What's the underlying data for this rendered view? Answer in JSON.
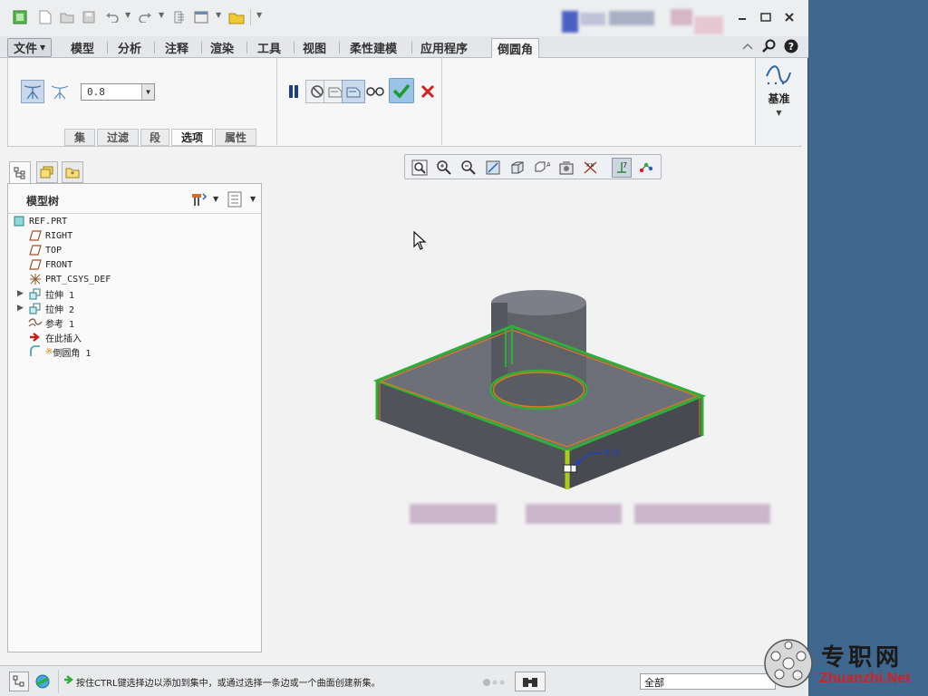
{
  "ribbon_tabs": [
    {
      "label": "文件"
    },
    {
      "label": "模型"
    },
    {
      "label": "分析"
    },
    {
      "label": "注释"
    },
    {
      "label": "渲染"
    },
    {
      "label": "工具"
    },
    {
      "label": "视图"
    },
    {
      "label": "柔性建模"
    },
    {
      "label": "应用程序"
    },
    {
      "label": "倒圆角"
    }
  ],
  "round_tool": {
    "radius_value": "0.8",
    "datum_label": "基准",
    "subtabs": [
      "集",
      "过滤",
      "段",
      "选项",
      "属性"
    ],
    "active_subtab": "选项"
  },
  "model_tree": {
    "title": "模型树",
    "items": [
      {
        "label": "REF.PRT",
        "icon": "part-icon",
        "expandable": false
      },
      {
        "label": "RIGHT",
        "icon": "datum-plane-icon",
        "expandable": false
      },
      {
        "label": "TOP",
        "icon": "datum-plane-icon",
        "expandable": false
      },
      {
        "label": "FRONT",
        "icon": "datum-plane-icon",
        "expandable": false
      },
      {
        "label": "PRT_CSYS_DEF",
        "icon": "csys-icon",
        "expandable": false
      },
      {
        "label": "拉伸 1",
        "icon": "extrude-icon",
        "expandable": true
      },
      {
        "label": "拉伸 2",
        "icon": "extrude-icon",
        "expandable": true
      },
      {
        "label": "参考 1",
        "icon": "reference-icon",
        "expandable": false
      },
      {
        "label": "在此插入",
        "icon": "insert-here-icon",
        "expandable": false
      },
      {
        "label": "倒圆角 1",
        "icon": "round-icon",
        "expandable": false
      }
    ],
    "round_prefix": "※"
  },
  "graphics": {
    "dimension_label": "0.8"
  },
  "status_bar": {
    "message": "按住CTRL键选择边以添加到集中，或通过选择一条边或一个曲面创建新集。",
    "filter_value": "全部"
  },
  "watermark": {
    "cn": "专职网",
    "en": "Zhuanzhi.Net"
  },
  "colors": {
    "accent_green": "#2fae3a",
    "cancel_red": "#d42020",
    "edge_orange": "#e07a1a",
    "model_grey": "#5e6167",
    "desktop_blue": "#40688f"
  }
}
